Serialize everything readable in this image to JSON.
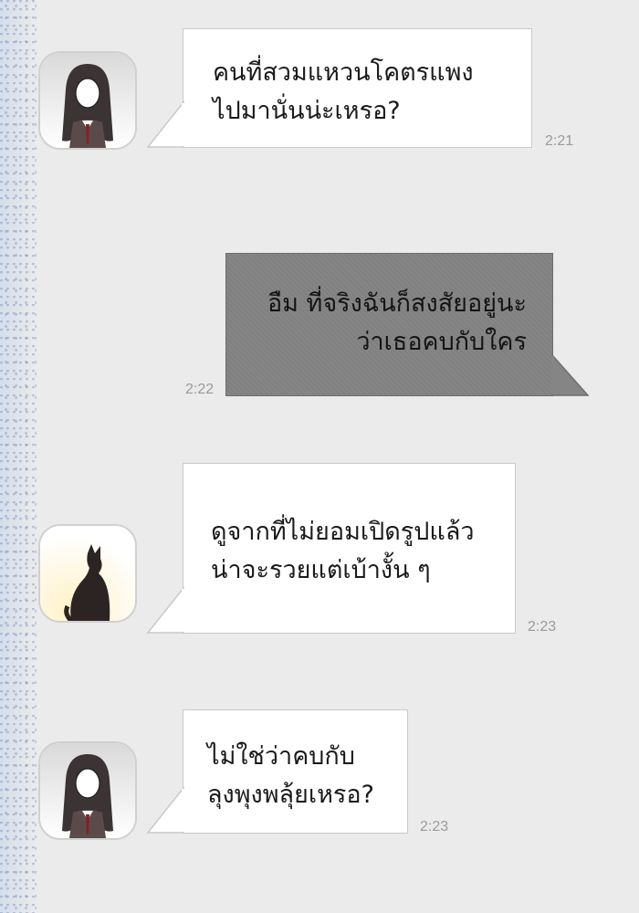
{
  "chat": {
    "messages": [
      {
        "sender": "girl",
        "lines": [
          "คนที่สวมแหวนโคตรแพง",
          "ไปมานั่นน่ะเหรอ?"
        ],
        "time": "2:21"
      },
      {
        "sender": "me",
        "lines": [
          "อืม ที่จริงฉันก็สงสัยอยู่นะ",
          "ว่าเธอคบกับใคร"
        ],
        "time": "2:22"
      },
      {
        "sender": "cat",
        "lines": [
          "ดูจากที่ไม่ยอมเปิดรูปแล้ว",
          "น่าจะรวยแต่เบ้างั้น ๆ"
        ],
        "time": "2:23"
      },
      {
        "sender": "girl",
        "lines": [
          "ไม่ใช่ว่าคบกับ",
          "ลุงพุงพลุ้ยเหรอ?"
        ],
        "time": "2:23"
      }
    ]
  },
  "avatars": {
    "girl": "avatar-long-haired-girl",
    "cat": "avatar-black-cat"
  },
  "colors": {
    "background": "#ebebeb",
    "received_bubble": "#ffffff",
    "sent_bubble": "#858585",
    "timestamp": "#9a9a9a"
  }
}
